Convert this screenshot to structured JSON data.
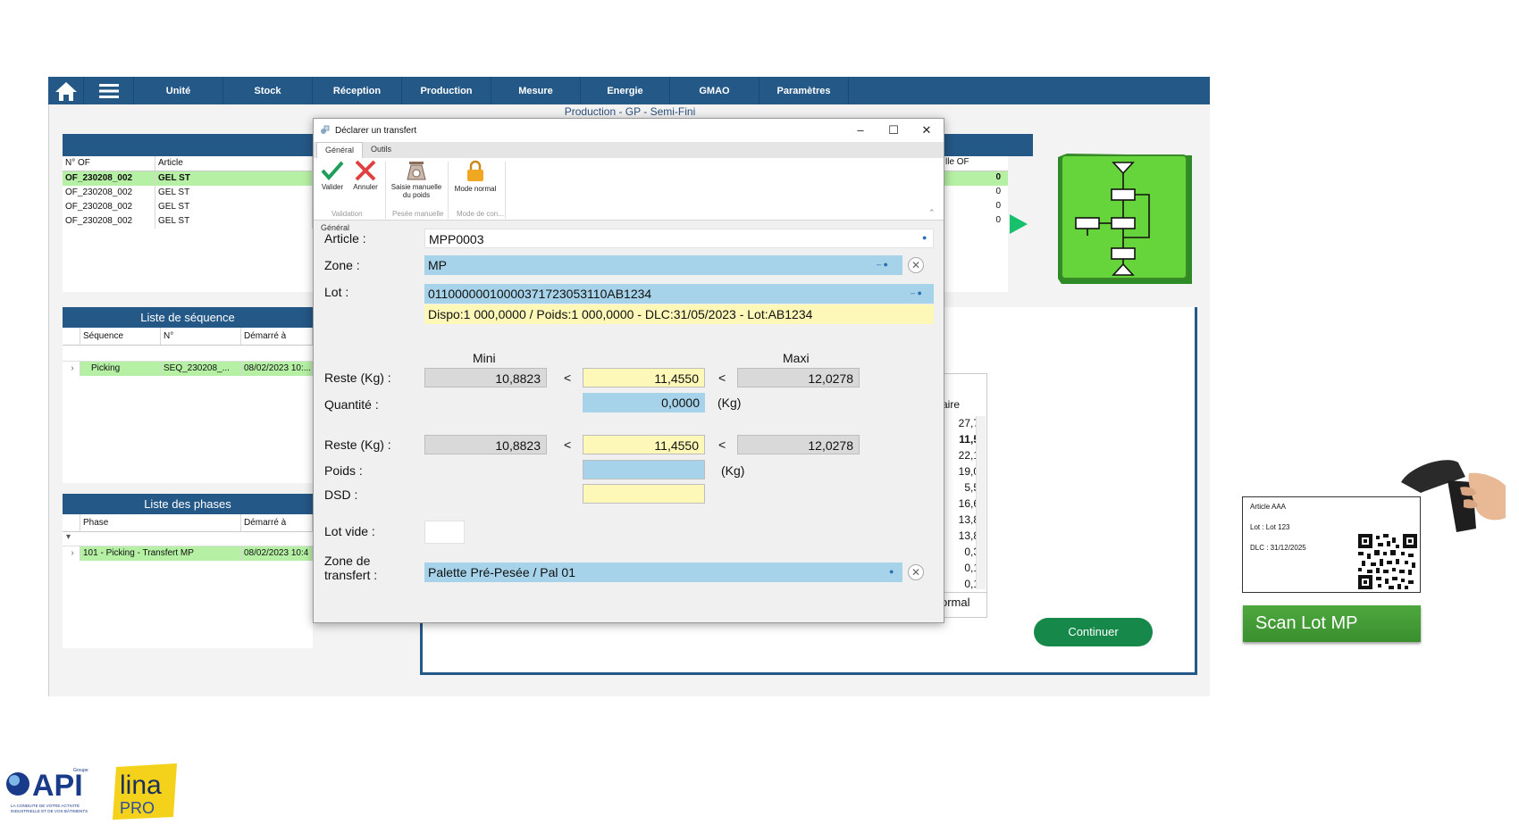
{
  "topbar": {
    "nav": [
      "Unité",
      "Stock",
      "Réception",
      "Production",
      "Mesure",
      "Energie",
      "GMAO",
      "Paramètres"
    ]
  },
  "page_subtitle": "Production - GP - Semi-Fini",
  "of_table": {
    "headers": [
      "N° OF",
      "Article"
    ],
    "right_header": "lle OF",
    "rows": [
      {
        "of": "OF_230208_002",
        "article": "GEL ST",
        "val": "0"
      },
      {
        "of": "OF_230208_002",
        "article": "GEL ST",
        "val": "0"
      },
      {
        "of": "OF_230208_002",
        "article": "GEL ST",
        "val": "0"
      },
      {
        "of": "OF_230208_002",
        "article": "GEL ST",
        "val": "0"
      }
    ]
  },
  "sequences": {
    "title": "Liste de séquence",
    "headers": [
      "Séquence",
      "N°",
      "Démarré à"
    ],
    "row": {
      "seq": "Picking",
      "num": "SEQ_230208_...",
      "start": "08/02/2023 10:..."
    }
  },
  "phases": {
    "title": "Liste des phases",
    "headers": [
      "Phase",
      "Démarré à"
    ],
    "row": {
      "phase": "101 - Picking - Transfert MP",
      "start": "08/02/2023 10:4"
    }
  },
  "stub_list": {
    "header": "aire",
    "values": [
      "27,7",
      "11,5",
      "22,1",
      "19,0",
      "5,5",
      "16,6",
      "13,8",
      "13,8",
      "0,3",
      "0,1",
      "0,1"
    ],
    "footer": "ormal"
  },
  "continue_label": "Continuer",
  "dialog": {
    "title": "Déclarer un transfert",
    "tabs": [
      "Général",
      "Outils"
    ],
    "ribbon": {
      "validate": "Valider",
      "cancel": "Annuler",
      "manual_weight_1": "Saisie manuelle",
      "manual_weight_2": "du poids",
      "normal_mode": "Mode normal",
      "group_validation": "Validation",
      "group_pesee": "Pesée manuelle",
      "group_mode": "Mode de con..."
    },
    "group_label": "Général",
    "labels": {
      "article": "Article :",
      "zone": "Zone :",
      "lot": "Lot :",
      "mini": "Mini",
      "maxi": "Maxi",
      "reste1": "Reste (Kg) :",
      "quantite": "Quantité :",
      "reste2": "Reste (Kg) :",
      "poids": "Poids :",
      "dsd": "DSD :",
      "lot_vide": "Lot vide :",
      "zone_transfert_1": "Zone de",
      "zone_transfert_2": "transfert :",
      "unit_kg": "(Kg)",
      "lt": "<"
    },
    "values": {
      "article": "MPP0003",
      "zone": "MP",
      "lot": "01100000010000371723053110AB1234",
      "lot_info": "Dispo:1 000,0000 / Poids:1 000,0000 - DLC:31/05/2023 - Lot:AB1234",
      "reste1_min": "10,8823",
      "reste1_val": "11,4550",
      "reste1_max": "12,0278",
      "quantite": "0,0000",
      "reste2_min": "10,8823",
      "reste2_val": "11,4550",
      "reste2_max": "12,0278",
      "poids": "",
      "dsd": "",
      "zone_transfert": "Palette Pré-Pesée / Pal 01"
    }
  },
  "label_card": {
    "line1": "Article AAA",
    "line2": "Lot : Lot 123",
    "line3": "DLC : 31/12/2025"
  },
  "scan_button": "Scan Lot MP",
  "logos": {
    "api_text": "API",
    "api_top": "Groupe",
    "api_tag1": "LA CONDUITE DE VOTRE ACTIVITÉ",
    "api_tag2": "INDUSTRIELLE ET DE VOS BÂTIMENTS",
    "lina_text": "lina",
    "pro_text": "PRO"
  },
  "colors": {
    "nav_blue": "#245887",
    "accent_green": "#16884a",
    "field_blue": "#a6d3e9",
    "field_yellow": "#fef8b8"
  }
}
